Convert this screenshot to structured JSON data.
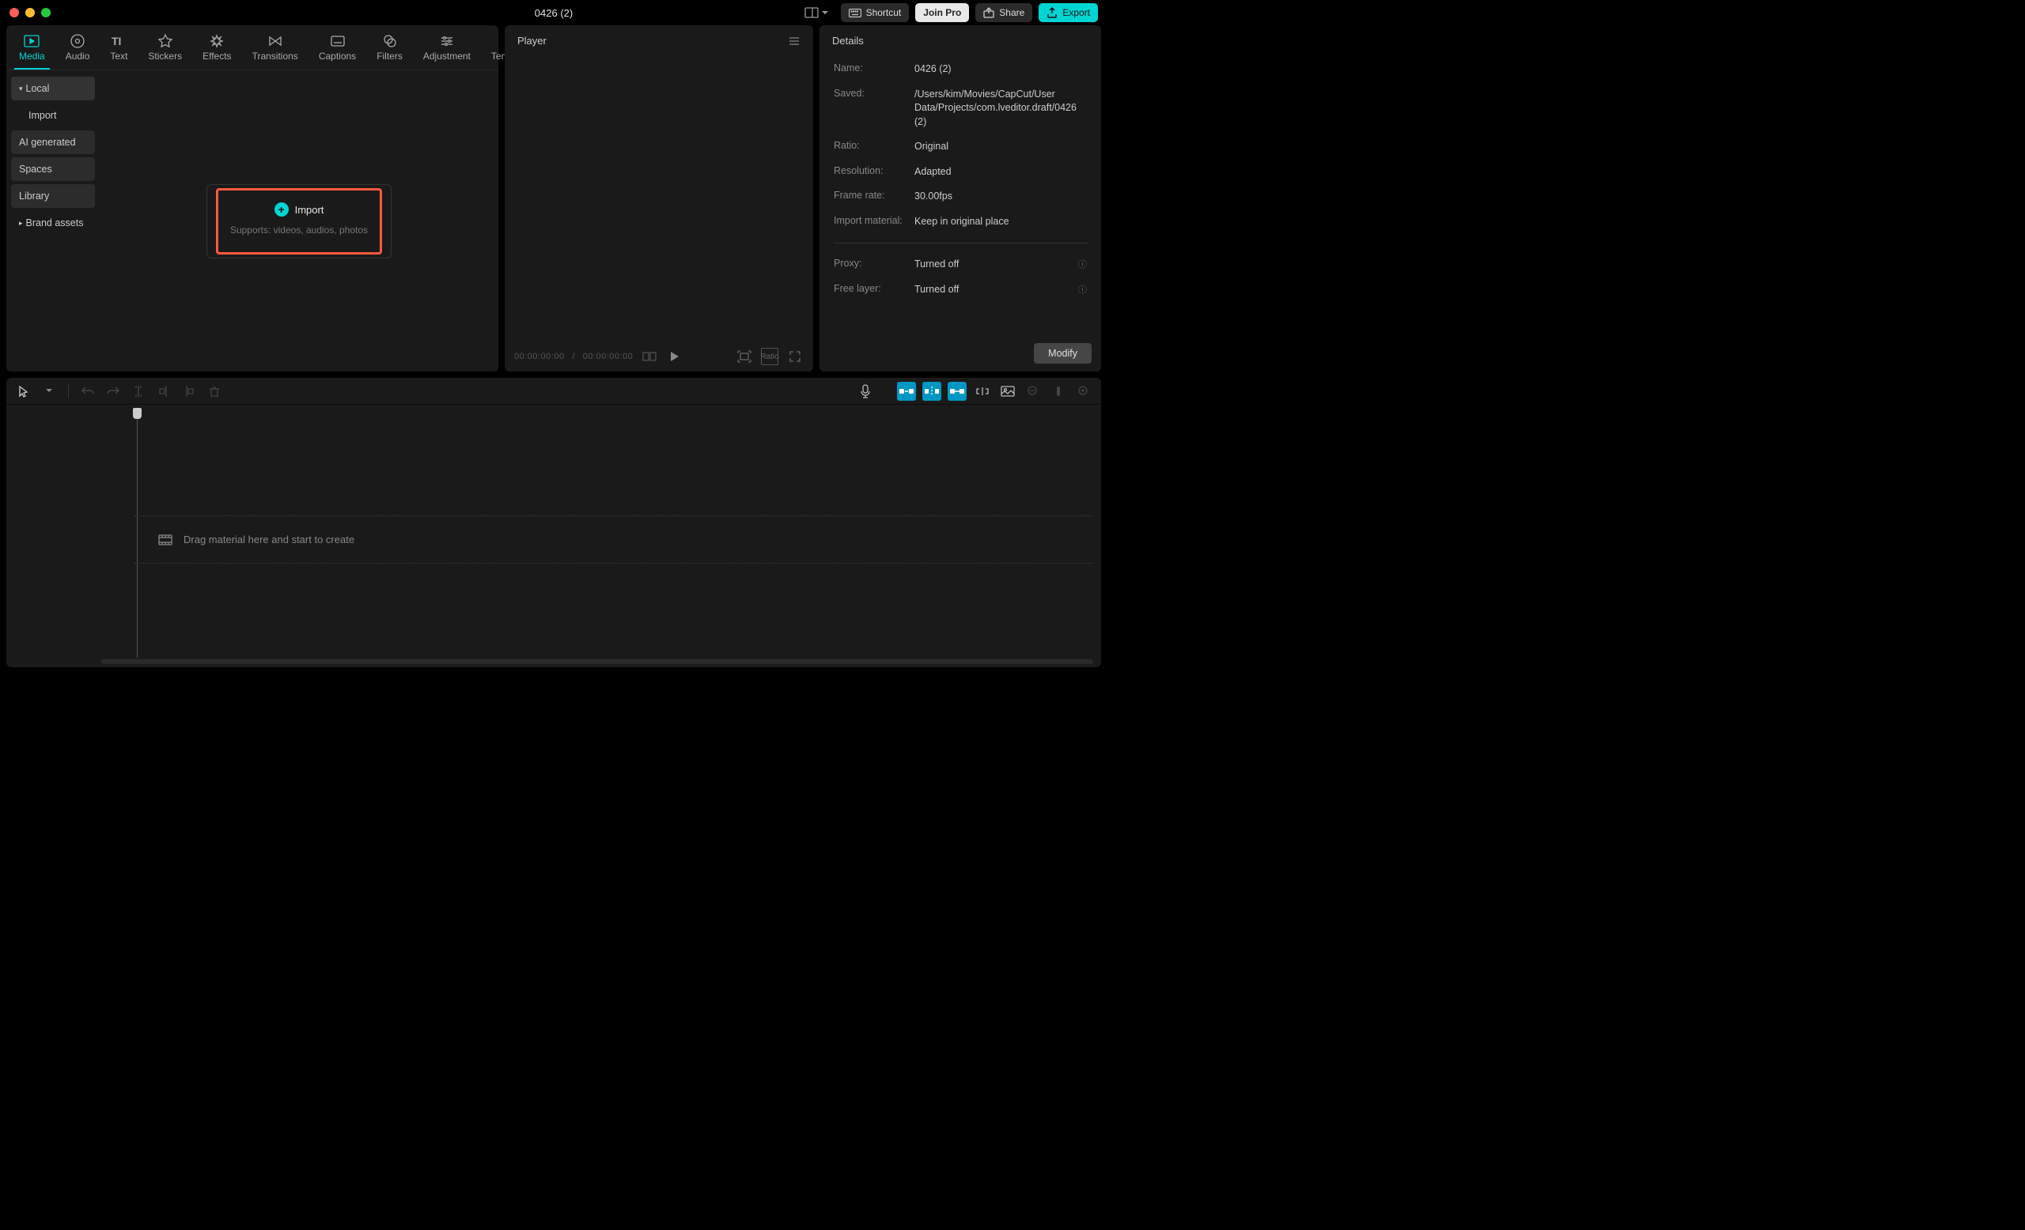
{
  "titlebar": {
    "title": "0426 (2)",
    "shortcut": "Shortcut",
    "joinPro": "Join Pro",
    "share": "Share",
    "export": "Export"
  },
  "toolTabs": [
    {
      "id": "media",
      "label": "Media"
    },
    {
      "id": "audio",
      "label": "Audio"
    },
    {
      "id": "text",
      "label": "Text"
    },
    {
      "id": "stickers",
      "label": "Stickers"
    },
    {
      "id": "effects",
      "label": "Effects"
    },
    {
      "id": "transitions",
      "label": "Transitions"
    },
    {
      "id": "captions",
      "label": "Captions"
    },
    {
      "id": "filters",
      "label": "Filters"
    },
    {
      "id": "adjustment",
      "label": "Adjustment"
    },
    {
      "id": "templates",
      "label": "Templates"
    }
  ],
  "mediaSidebar": {
    "local": "Local",
    "import": "Import",
    "ai": "AI generated",
    "spaces": "Spaces",
    "library": "Library",
    "brand": "Brand assets"
  },
  "importCard": {
    "title": "Import",
    "subtitle": "Supports: videos, audios, photos"
  },
  "player": {
    "header": "Player",
    "timeCurrent": "00:00:00:00",
    "timeTotal": "00:00:00:00",
    "ratioLabel": "Ratio"
  },
  "details": {
    "header": "Details",
    "rows": {
      "nameLabel": "Name:",
      "nameValue": "0426 (2)",
      "savedLabel": "Saved:",
      "savedValue": "/Users/kim/Movies/CapCut/User Data/Projects/com.lveditor.draft/0426 (2)",
      "ratioLabel": "Ratio:",
      "ratioValue": "Original",
      "resolutionLabel": "Resolution:",
      "resolutionValue": "Adapted",
      "framerateLabel": "Frame rate:",
      "framerateValue": "30.00fps",
      "importLabel": "Import material:",
      "importValue": "Keep in original place",
      "proxyLabel": "Proxy:",
      "proxyValue": "Turned off",
      "freelayerLabel": "Free layer:",
      "freelayerValue": "Turned off"
    },
    "modify": "Modify"
  },
  "timeline": {
    "hint": "Drag material here and start to create"
  }
}
